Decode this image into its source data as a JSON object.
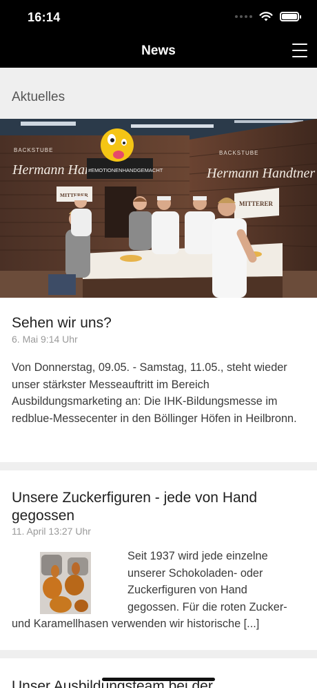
{
  "status_bar": {
    "time": "16:14"
  },
  "nav": {
    "title": "News"
  },
  "section": {
    "title": "Aktuelles"
  },
  "posts": [
    {
      "title": "Sehen wir uns?",
      "date": "6. Mai 9:14 Uhr",
      "body": "Von Donnerstag, 09.05. - Samstag, 11.05., steht wieder unser stärkster Messeauftritt im Bereich Ausbildungsmarketing an: Die IHK-Bildungsmesse im redblue-Messecenter in den Böllinger Höfen in Heilbronn.",
      "image_text": {
        "backstube_left": "BACKSTUBE",
        "backstube_right": "BACKSTUBE",
        "script_left": "Hermann Handtner",
        "script_right": "Hermann Handtner",
        "hashtag": "#EMOTIONENHANDGEMACHT",
        "mitterer_left": "MITTERER",
        "mitterer_right": "MITTERER"
      }
    },
    {
      "title_line1": "Unsere Zuckerfiguren - jede von Hand",
      "title_line2": "gegossen",
      "date": "11. April 13:27 Uhr",
      "body_lines": [
        "Seit 1937 wird jede einzelne",
        "unserer Schokoladen- oder",
        "Zuckerfiguren von Hand",
        "gegossen. Für die roten Zucker-",
        "und Karamellhasen verwenden wir historische [...]"
      ]
    },
    {
      "title": "Unser Ausbildungsteam bei der"
    }
  ]
}
